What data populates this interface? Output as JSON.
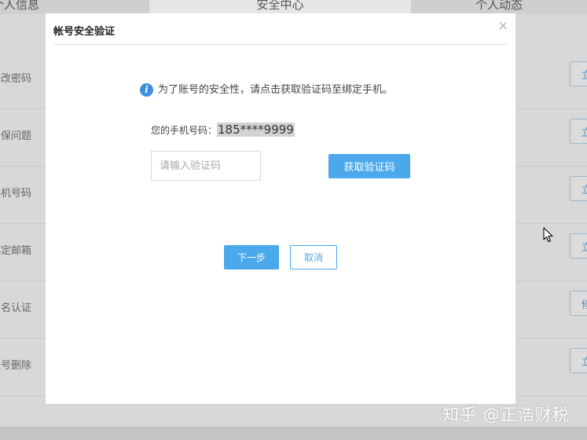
{
  "background": {
    "tabs": [
      "个人信息",
      "安全中心",
      "个人动态"
    ],
    "rows": [
      {
        "label": "修改密码",
        "action": "立"
      },
      {
        "label": "密保问题",
        "action": "立"
      },
      {
        "label": "手机号码",
        "action": "立"
      },
      {
        "label": "绑定邮箱",
        "action": "立"
      },
      {
        "label": "实名认证",
        "action": "修"
      },
      {
        "label": "账号删除",
        "action": "立"
      }
    ]
  },
  "modal": {
    "title": "帐号安全验证",
    "close_symbol": "×",
    "notice_icon": "i",
    "notice": "为了账号的安全性，请点击获取验证码至绑定手机。",
    "phone_label": "您的手机号码：",
    "phone_number": "185****9999",
    "code_placeholder": "请输入验证码",
    "code_value": "",
    "get_code_button": "获取验证码",
    "next_button": "下一步",
    "cancel_button": "取消"
  },
  "watermark": "知乎 @正浩财税",
  "colors": {
    "accent": "#4ba8ea",
    "info_icon": "#3b8ee0",
    "overlay_bg": "#d8d8d8"
  },
  "icons": {
    "info": "info-circle-icon",
    "close": "close-icon",
    "cursor": "mouse-pointer-icon"
  }
}
